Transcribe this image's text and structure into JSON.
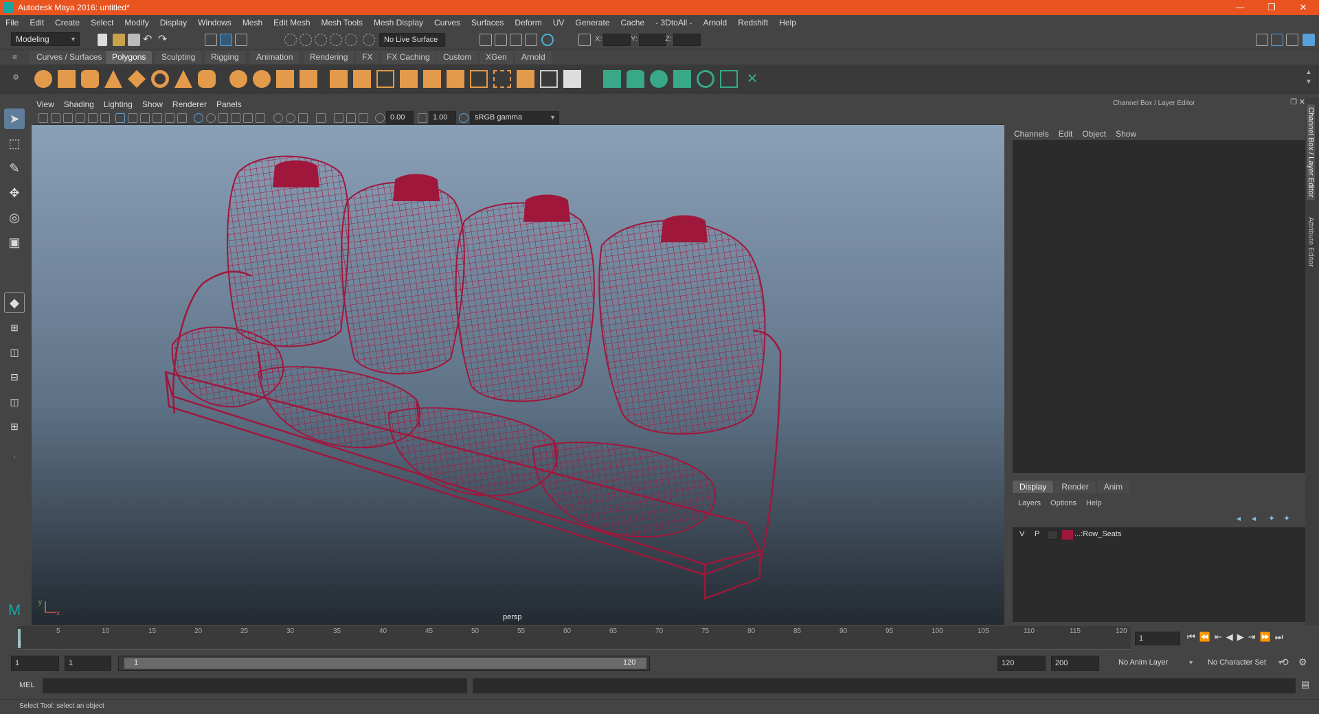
{
  "window": {
    "title": "Autodesk Maya 2016: untitled*",
    "controls": [
      "—",
      "❐",
      "✕"
    ]
  },
  "menubar": [
    "File",
    "Edit",
    "Create",
    "Select",
    "Modify",
    "Display",
    "Windows",
    "Mesh",
    "Edit Mesh",
    "Mesh Tools",
    "Mesh Display",
    "Curves",
    "Surfaces",
    "Deform",
    "UV",
    "Generate",
    "Cache",
    "- 3DtoAll -",
    "Arnold",
    "Redshift",
    "Help"
  ],
  "statusline": {
    "mode": "Modeling",
    "live_surface": "No Live Surface",
    "x_label": "X:",
    "y_label": "Y:",
    "z_label": "Z:"
  },
  "shelf_tabs": [
    "Curves / Surfaces",
    "Polygons",
    "Sculpting",
    "Rigging",
    "Animation",
    "Rendering",
    "FX",
    "FX Caching",
    "Custom",
    "XGen",
    "Arnold"
  ],
  "shelf_active": "Polygons",
  "panel_menu": [
    "View",
    "Shading",
    "Lighting",
    "Show",
    "Renderer",
    "Panels"
  ],
  "panel_toolbar": {
    "exposure": "0.00",
    "gamma": "1.00",
    "color_space": "sRGB gamma"
  },
  "viewport": {
    "camera": "persp",
    "axis_y": "y",
    "axis_x": "x"
  },
  "channel_box": {
    "header": "Channel Box / Layer Editor",
    "menus": [
      "Channels",
      "Edit",
      "Object",
      "Show"
    ]
  },
  "layer_editor": {
    "tabs": [
      "Display",
      "Render",
      "Anim"
    ],
    "menus": [
      "Layers",
      "Options",
      "Help"
    ],
    "layers": [
      {
        "v": "V",
        "p": "P",
        "name": "...:Row_Seats",
        "color": "#a0173c"
      }
    ]
  },
  "side_tabs": [
    "Channel Box / Layer Editor",
    "Attribute Editor"
  ],
  "timeline": {
    "ticks": [
      "5",
      "10",
      "15",
      "20",
      "25",
      "30",
      "35",
      "40",
      "45",
      "50",
      "55",
      "60",
      "65",
      "70",
      "75",
      "80",
      "85",
      "90",
      "95",
      "100",
      "105",
      "110",
      "115",
      "120"
    ],
    "start": "1",
    "current_frame": "1"
  },
  "range": {
    "start": "1",
    "anim_start": "1",
    "slider_start": "1",
    "slider_end": "120",
    "end": "120",
    "anim_end": "200",
    "anim_layer": "No Anim Layer",
    "char_set": "No Character Set"
  },
  "cmdline": {
    "label": "MEL"
  },
  "helpline": {
    "text": "Select Tool: select an object"
  },
  "colors": {
    "wire": "#a0173c",
    "title_bar": "#e8531f"
  }
}
